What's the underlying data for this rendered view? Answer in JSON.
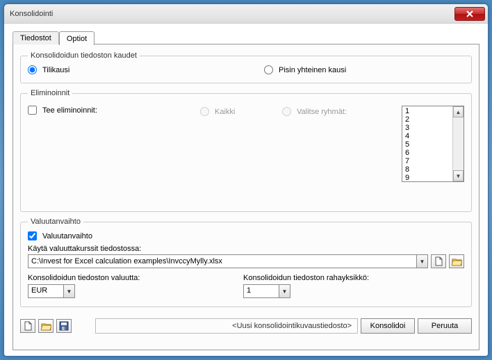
{
  "window": {
    "title": "Konsolidointi"
  },
  "tabs": {
    "files": "Tiedostot",
    "options": "Optiot"
  },
  "periods": {
    "legend": "Konsolidoidun tiedoston kaudet",
    "opt_fiscal": "Tilikausi",
    "opt_common": "Pisin yhteinen kausi"
  },
  "elim": {
    "legend": "Eliminoinnit",
    "chk_label": "Tee eliminoinnit:",
    "opt_all": "Kaikki",
    "opt_select": "Valitse ryhmät:",
    "items": [
      "1",
      "2",
      "3",
      "4",
      "5",
      "6",
      "7",
      "8",
      "9"
    ]
  },
  "fx": {
    "legend": "Valuutanvaihto",
    "chk_label": "Valuutanvaihto",
    "file_label": "Käytä valuuttakurssit tiedostossa:",
    "file_path": "C:\\Invest for Excel calculation examples\\InvccyMylly.xlsx",
    "currency_label": "Konsolidoidun tiedoston valuutta:",
    "currency_value": "EUR",
    "unit_label": "Konsolidoidun tiedoston rahayksikkö:",
    "unit_value": "1"
  },
  "footer": {
    "status": "<Uusi konsolidointikuvaustiedosto>",
    "consolidate": "Konsolidoi",
    "cancel": "Peruuta"
  },
  "icons": {
    "new": "new-file-icon",
    "open": "open-folder-icon",
    "save": "save-icon",
    "close": "close-icon"
  }
}
